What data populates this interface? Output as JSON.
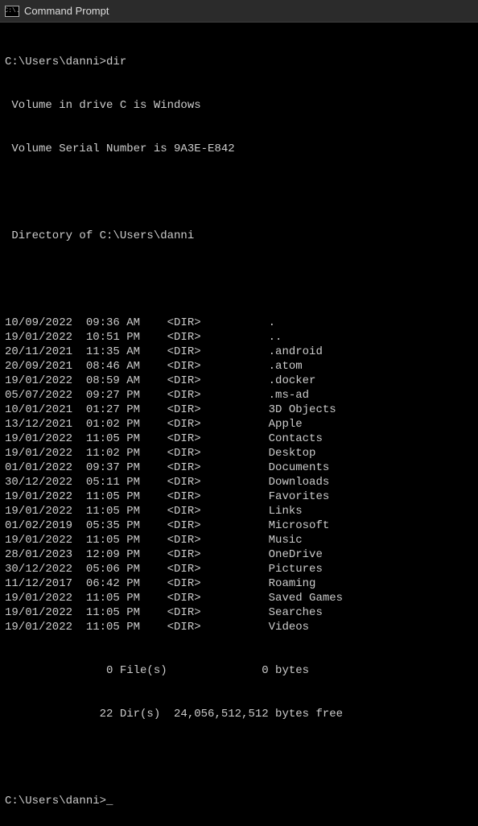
{
  "window": {
    "title": "Command Prompt",
    "icon_label": "C:\\."
  },
  "prompt1": "C:\\Users\\danni>",
  "command1": "dir",
  "vol_line": " Volume in drive C is Windows",
  "serial_line": " Volume Serial Number is 9A3E-E842",
  "dir_of_line": " Directory of C:\\Users\\danni",
  "entries": [
    {
      "date": "10/09/2022",
      "time": "09:36 AM",
      "type": "<DIR>",
      "name": "."
    },
    {
      "date": "19/01/2022",
      "time": "10:51 PM",
      "type": "<DIR>",
      "name": ".."
    },
    {
      "date": "20/11/2021",
      "time": "11:35 AM",
      "type": "<DIR>",
      "name": ".android"
    },
    {
      "date": "20/09/2021",
      "time": "08:46 AM",
      "type": "<DIR>",
      "name": ".atom"
    },
    {
      "date": "19/01/2022",
      "time": "08:59 AM",
      "type": "<DIR>",
      "name": ".docker"
    },
    {
      "date": "05/07/2022",
      "time": "09:27 PM",
      "type": "<DIR>",
      "name": ".ms-ad"
    },
    {
      "date": "10/01/2021",
      "time": "01:27 PM",
      "type": "<DIR>",
      "name": "3D Objects"
    },
    {
      "date": "13/12/2021",
      "time": "01:02 PM",
      "type": "<DIR>",
      "name": "Apple"
    },
    {
      "date": "19/01/2022",
      "time": "11:05 PM",
      "type": "<DIR>",
      "name": "Contacts"
    },
    {
      "date": "19/01/2022",
      "time": "11:02 PM",
      "type": "<DIR>",
      "name": "Desktop"
    },
    {
      "date": "01/01/2022",
      "time": "09:37 PM",
      "type": "<DIR>",
      "name": "Documents"
    },
    {
      "date": "30/12/2022",
      "time": "05:11 PM",
      "type": "<DIR>",
      "name": "Downloads"
    },
    {
      "date": "19/01/2022",
      "time": "11:05 PM",
      "type": "<DIR>",
      "name": "Favorites"
    },
    {
      "date": "19/01/2022",
      "time": "11:05 PM",
      "type": "<DIR>",
      "name": "Links"
    },
    {
      "date": "01/02/2019",
      "time": "05:35 PM",
      "type": "<DIR>",
      "name": "Microsoft"
    },
    {
      "date": "19/01/2022",
      "time": "11:05 PM",
      "type": "<DIR>",
      "name": "Music"
    },
    {
      "date": "28/01/2023",
      "time": "12:09 PM",
      "type": "<DIR>",
      "name": "OneDrive"
    },
    {
      "date": "30/12/2022",
      "time": "05:06 PM",
      "type": "<DIR>",
      "name": "Pictures"
    },
    {
      "date": "11/12/2017",
      "time": "06:42 PM",
      "type": "<DIR>",
      "name": "Roaming"
    },
    {
      "date": "19/01/2022",
      "time": "11:05 PM",
      "type": "<DIR>",
      "name": "Saved Games"
    },
    {
      "date": "19/01/2022",
      "time": "11:05 PM",
      "type": "<DIR>",
      "name": "Searches"
    },
    {
      "date": "19/01/2022",
      "time": "11:05 PM",
      "type": "<DIR>",
      "name": "Videos"
    }
  ],
  "summary": {
    "files_line": "               0 File(s)              0 bytes",
    "dirs_line": "              22 Dir(s)  24,056,512,512 bytes free"
  },
  "prompt2": "C:\\Users\\danni>"
}
